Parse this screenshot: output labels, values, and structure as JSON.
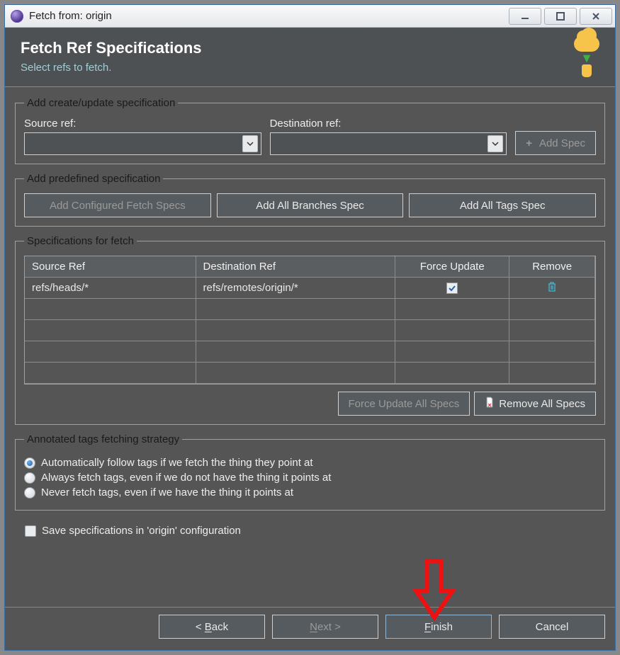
{
  "window": {
    "title": "Fetch from: origin"
  },
  "header": {
    "title": "Fetch Ref Specifications",
    "subtitle": "Select refs to fetch."
  },
  "addSpec": {
    "legend": "Add create/update specification",
    "sourceLabel": "Source ref:",
    "destLabel": "Destination ref:",
    "addBtn": "Add Spec"
  },
  "predefined": {
    "legend": "Add predefined specification",
    "configured": "Add Configured Fetch Specs",
    "allBranches": "Add All Branches Spec",
    "allTags": "Add All Tags Spec"
  },
  "specs": {
    "legend": "Specifications for fetch",
    "cols": {
      "source": "Source Ref",
      "dest": "Destination Ref",
      "force": "Force Update",
      "remove": "Remove"
    },
    "rows": [
      {
        "source": "refs/heads/*",
        "dest": "refs/remotes/origin/*",
        "force": true
      }
    ],
    "forceAll": "Force Update All Specs",
    "removeAll": "Remove All Specs"
  },
  "tags": {
    "legend": "Annotated tags fetching strategy",
    "options": [
      "Automatically follow tags if we fetch the thing they point at",
      "Always fetch tags, even if we do not have the thing it points at",
      "Never fetch tags, even if we have the thing it points at"
    ],
    "selected": 0
  },
  "saveCfg": {
    "label": "Save specifications in 'origin' configuration",
    "checked": false
  },
  "footer": {
    "back": "< Back",
    "next": "Next >",
    "finish": "Finish",
    "cancel": "Cancel"
  }
}
